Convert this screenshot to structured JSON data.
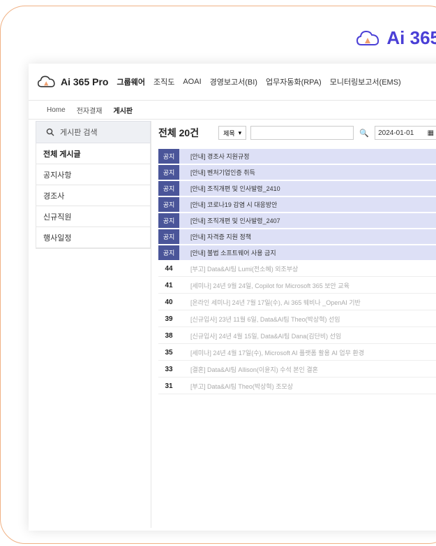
{
  "brand": {
    "text": "Ai 365",
    "color": "#4a3fd6"
  },
  "app": {
    "logo_text": "Ai 365 Pro",
    "nav": [
      "그룹웨어",
      "조직도",
      "AOAI",
      "경영보고서(BI)",
      "업무자동화(RPA)",
      "모니터링보고서(EMS)"
    ],
    "active_nav": "그룹웨어"
  },
  "subnav": [
    "Home",
    "전자결재",
    "게시판"
  ],
  "sidebar": {
    "search_placeholder": "게시판 검색",
    "items": [
      "전체 게시글",
      "공지사항",
      "경조사",
      "신규직원",
      "행사일정"
    ]
  },
  "main": {
    "total_label": "전체 20건",
    "filter_select": "제목",
    "date_value": "2024-01-01",
    "notice_tag": "공지",
    "notices": [
      "[안내] 경조사 지원규정",
      "[안내] 벤처기업인증 취득",
      "[안내] 조직개편 및 인사발령_2410",
      "[안내] 코로나19 감염 시 대응방안",
      "[안내] 조직개편 및 인사발령_2407",
      "[안내] 자격증 지원 정책",
      "[안내] 불법 소프트웨어 사용 금지"
    ],
    "posts": [
      {
        "num": "44",
        "title": "[부고] Data&AI팀 Lumi(전소혜) 외조부상"
      },
      {
        "num": "41",
        "title": "[세미나] 24년 9월 24일, Copilot for Microsoft 365 보안 교육"
      },
      {
        "num": "40",
        "title": "[온라인 세미나] 24년 7월 17일(수), Ai 365 웨비나 _OpenAI 기반"
      },
      {
        "num": "39",
        "title": "[신규입사] 23년 11월 6일, Data&AI팀 Theo(박상혁) 선임"
      },
      {
        "num": "38",
        "title": "[신규입사] 24년 4월 15일, Data&AI팀 Dana(김단비) 선임"
      },
      {
        "num": "35",
        "title": "[세미나] 24년 4월 17일(수), Microsoft AI 플랫폼 활용 AI 업무 환경"
      },
      {
        "num": "33",
        "title": "[결혼] Data&AI팀 Allison(이윤지) 수석 본인 결혼"
      },
      {
        "num": "31",
        "title": "[부고] Data&AI팀 Theo(박상혁) 조모상"
      }
    ]
  }
}
